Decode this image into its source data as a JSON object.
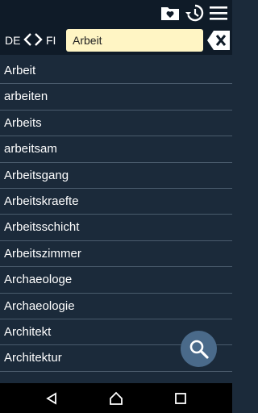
{
  "language": {
    "from": "DE",
    "to": "FI"
  },
  "search": {
    "value": "Arbeit"
  },
  "words": [
    "Arbeit",
    "arbeiten",
    "Arbeits",
    "arbeitsam",
    "Arbeitsgang",
    "Arbeitskraefte",
    "Arbeitsschicht",
    "Arbeitszimmer",
    "Archaeologe",
    "Archaeologie",
    "Architekt",
    "Architektur"
  ],
  "colors": {
    "background": "#1b2a3a",
    "header": "#0f1b28",
    "search_field": "#fff5c4",
    "fab": "#4a6a8a"
  },
  "icons": [
    "favorites-folder-icon",
    "history-icon",
    "menu-icon",
    "swap-left-icon",
    "swap-right-icon",
    "clear-icon",
    "search-icon",
    "back-icon",
    "home-icon",
    "recents-icon"
  ]
}
